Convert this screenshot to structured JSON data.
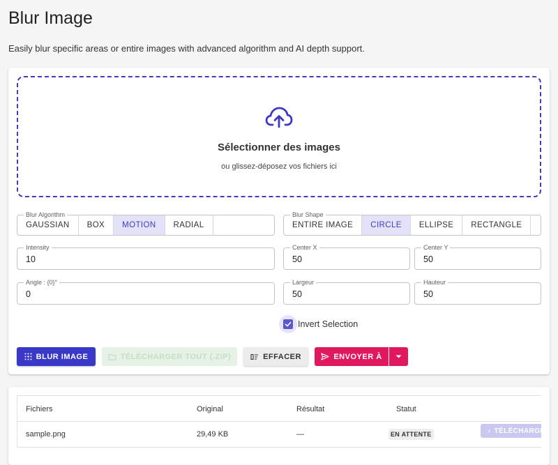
{
  "page": {
    "title": "Blur Image",
    "description": "Easily blur specific areas or entire images with advanced algorithm and AI depth support."
  },
  "dropzone": {
    "icon": "cloud-upload-icon",
    "title": "Sélectionner des images",
    "subtitle": "ou glissez-déposez vos fichiers ici"
  },
  "blur_algorithm": {
    "label": "Blur Algorithm",
    "options": [
      "GAUSSIAN",
      "BOX",
      "MOTION",
      "RADIAL"
    ],
    "selected": "MOTION"
  },
  "blur_shape": {
    "label": "Blur Shape",
    "options": [
      "ENTIRE IMAGE",
      "CIRCLE",
      "ELLIPSE",
      "RECTANGLE"
    ],
    "selected": "CIRCLE"
  },
  "fields": {
    "intensity": {
      "label": "Intensity",
      "value": "10"
    },
    "center_x": {
      "label": "Center X",
      "value": "50"
    },
    "center_y": {
      "label": "Center Y",
      "value": "50"
    },
    "angle": {
      "label": "Angle : {0}°",
      "value": "0"
    },
    "largeur": {
      "label": "Largeur",
      "value": "50"
    },
    "hauteur": {
      "label": "Hauteur",
      "value": "50"
    }
  },
  "invert_selection": {
    "label": "Invert Selection",
    "checked": true
  },
  "actions": {
    "blur": "BLUR IMAGE",
    "download_all": "TÉLÉCHARGER TOUT (.ZIP)",
    "clear": "EFFACER",
    "send_to": "ENVOYER À"
  },
  "colors": {
    "primary": "#3a38c7",
    "accent": "#e0195f",
    "selected_bg": "#e3e2f8"
  },
  "table": {
    "headers": [
      "Fichiers",
      "Original",
      "Résultat",
      "Statut"
    ],
    "rows": [
      {
        "file": "sample.png",
        "original": "29,49 KB",
        "result": "—",
        "status": "EN ATTENTE",
        "action": "TÉLÉCHARGER"
      }
    ]
  }
}
